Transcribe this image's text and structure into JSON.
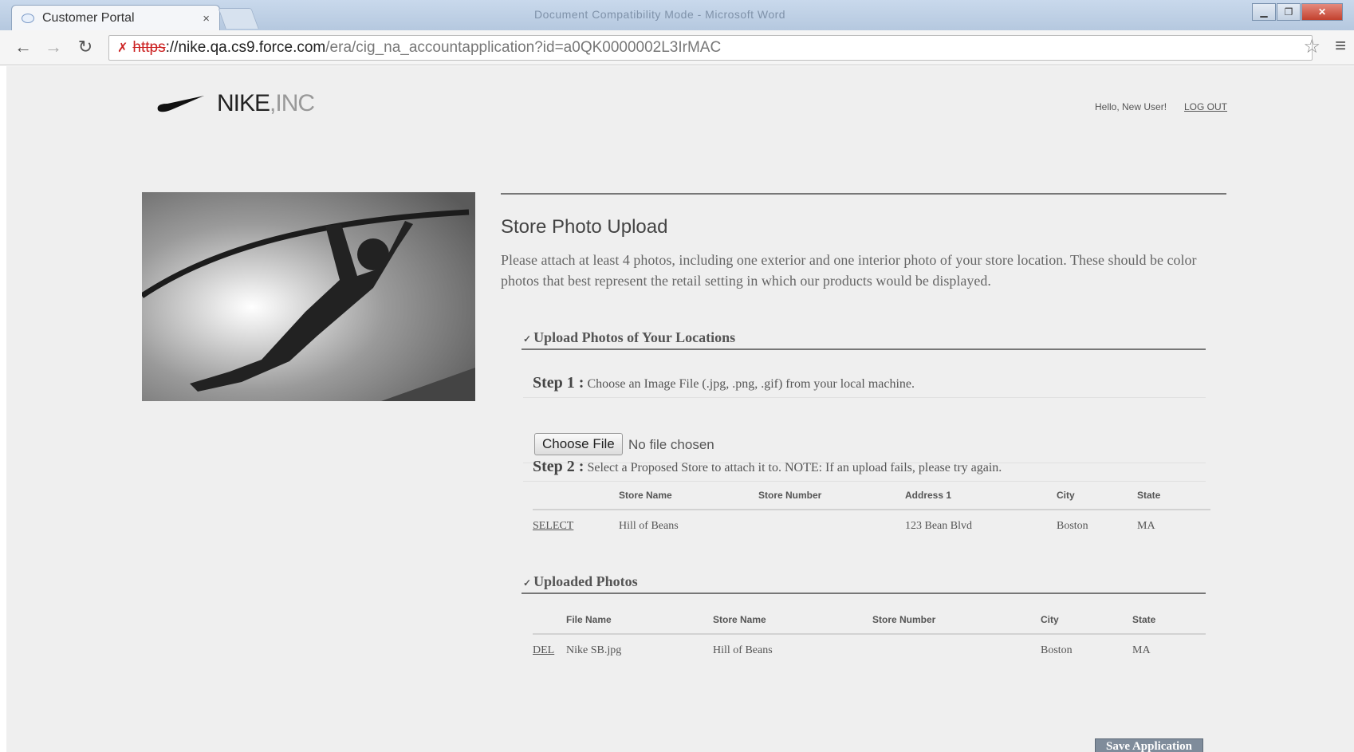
{
  "browser": {
    "tab_title": "Customer Portal",
    "tab_close": "×",
    "window_title": "Document Compatibility Mode - Microsoft Word",
    "url_scheme": "https",
    "url_host": "://nike.qa.cs9.force.com",
    "url_path": "/era/cig_na_accountapplication?id=a0QK0000002L3IrMAC",
    "icons": [
      "back-icon",
      "forward-icon",
      "reload-icon",
      "insecure-icon",
      "star-icon",
      "menu-icon"
    ]
  },
  "header": {
    "logo_text": "NIKE",
    "logo_suffix": ",INC",
    "greeting": "Hello, New User!",
    "logout": "LOG OUT"
  },
  "main": {
    "title": "Store Photo Upload",
    "intro": "Please attach at least 4 photos, including one exterior and one interior photo of your store location. These should be color photos that best represent the retail setting in which our products would be displayed.",
    "upload_section": {
      "title": "Upload Photos of Your Locations",
      "step1_label": "Step 1 :",
      "step1_text": "Choose an Image File (.jpg, .png, .gif) from your local machine.",
      "choose_file": "Choose File",
      "no_file": "No file chosen",
      "step2_label": "Step 2 :",
      "step2_text": "Select a Proposed Store to attach it to. NOTE: If an upload fails, please try again.",
      "stores_table": {
        "headers": [
          "",
          "Store Name",
          "Store Number",
          "Address 1",
          "City",
          "State"
        ],
        "rows": [
          [
            "SELECT",
            "Hill of Beans",
            "",
            "123 Bean Blvd",
            "Boston",
            "MA"
          ]
        ]
      }
    },
    "uploaded_section": {
      "title": "Uploaded Photos",
      "table": {
        "headers": [
          "",
          "File Name",
          "Store Name",
          "Store Number",
          "City",
          "State"
        ],
        "rows": [
          [
            "DEL",
            "Nike SB.jpg",
            "Hill of Beans",
            "",
            "Boston",
            "MA"
          ]
        ]
      }
    },
    "save_button": "Save Application"
  }
}
